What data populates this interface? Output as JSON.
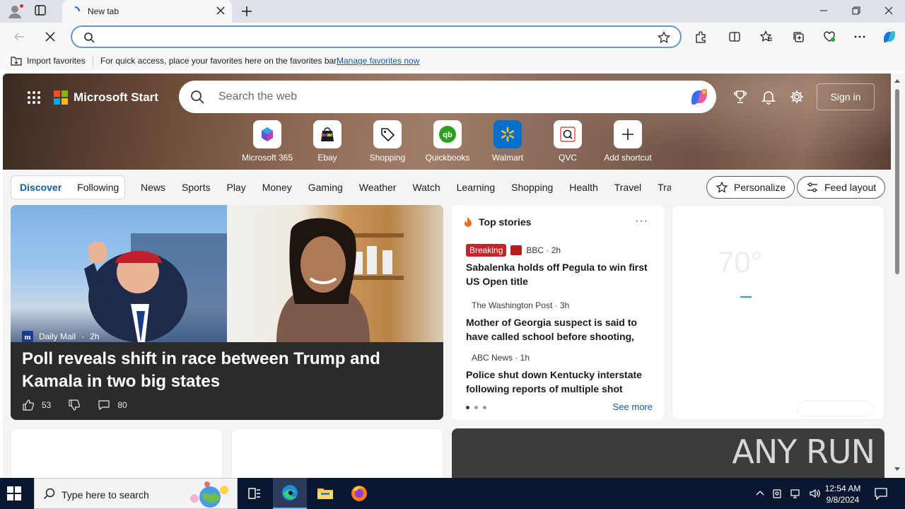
{
  "browser": {
    "tab_title": "New tab",
    "address_value": "",
    "favorites_bar": {
      "import_label": "Import favorites",
      "message": "For quick access, place your favorites here on the favorites bar.",
      "manage_link": "Manage favorites now"
    }
  },
  "start_page": {
    "brand": "Microsoft Start",
    "search_placeholder": "Search the web",
    "sign_in": "Sign in",
    "shortcuts": [
      {
        "label": "Microsoft 365",
        "icon": "m365-icon"
      },
      {
        "label": "Ebay",
        "icon": "ebay-icon"
      },
      {
        "label": "Shopping",
        "icon": "shopping-tag-icon"
      },
      {
        "label": "Quickbooks",
        "icon": "quickbooks-icon"
      },
      {
        "label": "Walmart",
        "icon": "walmart-icon"
      },
      {
        "label": "QVC",
        "icon": "qvc-icon"
      },
      {
        "label": "Add shortcut",
        "icon": "plus-icon"
      }
    ],
    "nav": {
      "discover": "Discover",
      "following": "Following",
      "links": [
        "News",
        "Sports",
        "Play",
        "Money",
        "Gaming",
        "Weather",
        "Watch",
        "Learning",
        "Shopping",
        "Health",
        "Travel",
        "Traf"
      ],
      "personalize": "Personalize",
      "feed_layout": "Feed layout"
    },
    "main_story": {
      "source": "Daily Mail",
      "age": "2h",
      "headline": "Poll reveals shift in race between Trump and Kamala in two big states",
      "likes": "53",
      "comments": "80"
    },
    "top_stories": {
      "title": "Top stories",
      "items": [
        {
          "badge": "Breaking",
          "source": "BBC · 2h",
          "title": "Sabalenka holds off Pegula to win first US Open title"
        },
        {
          "badge": "",
          "source": "The Washington Post · 3h",
          "title": "Mother of Georgia suspect is said to have called school before shooting, warning ..."
        },
        {
          "badge": "",
          "source": "ABC News · 1h",
          "title": "Police shut down Kentucky interstate following reports of multiple shot"
        }
      ],
      "see_more": "See more"
    },
    "weather": {
      "temp": "70°"
    },
    "watermark": "ANY RUN"
  },
  "taskbar": {
    "search_placeholder": "Type here to search",
    "time": "12:54 AM",
    "date": "9/8/2024"
  },
  "colors": {
    "accent": "#0f5cae",
    "breaking": "#c4262e",
    "taskbar": "#0b1730"
  }
}
